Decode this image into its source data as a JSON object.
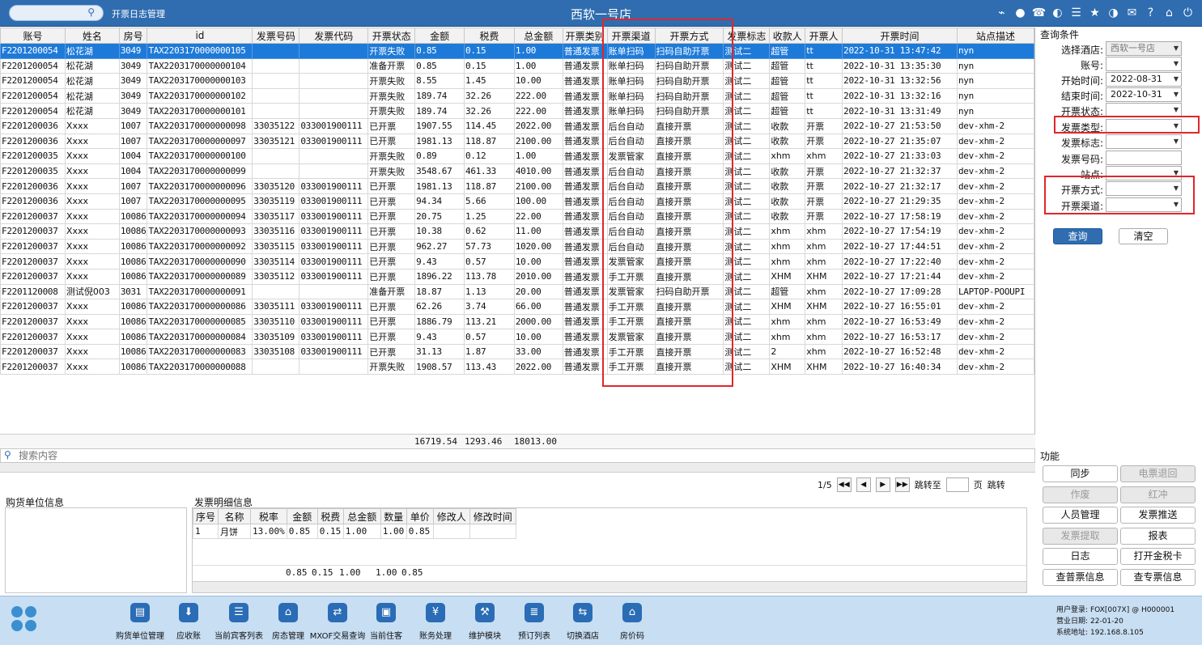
{
  "topbar": {
    "search_placeholder": "",
    "title": "开票日志管理",
    "hotel": "西软一号店",
    "icons": [
      "wifi-icon",
      "chat-icon",
      "phone-icon",
      "palette-icon",
      "menu-icon",
      "star-icon",
      "theme-icon",
      "mail-icon",
      "help-icon",
      "home-icon",
      "power-icon"
    ]
  },
  "grid": {
    "columns": [
      "账号",
      "姓名",
      "房号",
      "id",
      "发票号码",
      "发票代码",
      "开票状态",
      "金额",
      "税费",
      "总金额",
      "开票类别",
      "开票渠道",
      "开票方式",
      "发票标志",
      "收款人",
      "开票人",
      "开票时间",
      "站点描述"
    ],
    "rows": [
      [
        "F2201200054",
        "松花湖",
        "3049",
        "TAX2203170000000105",
        "",
        "",
        "开票失败",
        "0.85",
        "0.15",
        "1.00",
        "普通发票",
        "账单扫码",
        "扫码自助开票",
        "测试二",
        "超管",
        "tt",
        "2022-10-31 13:47:42",
        "nyn"
      ],
      [
        "F2201200054",
        "松花湖",
        "3049",
        "TAX2203170000000104",
        "",
        "",
        "准备开票",
        "0.85",
        "0.15",
        "1.00",
        "普通发票",
        "账单扫码",
        "扫码自助开票",
        "测试二",
        "超管",
        "tt",
        "2022-10-31 13:35:30",
        "nyn"
      ],
      [
        "F2201200054",
        "松花湖",
        "3049",
        "TAX2203170000000103",
        "",
        "",
        "开票失败",
        "8.55",
        "1.45",
        "10.00",
        "普通发票",
        "账单扫码",
        "扫码自助开票",
        "测试二",
        "超管",
        "tt",
        "2022-10-31 13:32:56",
        "nyn"
      ],
      [
        "F2201200054",
        "松花湖",
        "3049",
        "TAX2203170000000102",
        "",
        "",
        "开票失败",
        "189.74",
        "32.26",
        "222.00",
        "普通发票",
        "账单扫码",
        "扫码自助开票",
        "测试二",
        "超管",
        "tt",
        "2022-10-31 13:32:16",
        "nyn"
      ],
      [
        "F2201200054",
        "松花湖",
        "3049",
        "TAX2203170000000101",
        "",
        "",
        "开票失败",
        "189.74",
        "32.26",
        "222.00",
        "普通发票",
        "账单扫码",
        "扫码自助开票",
        "测试二",
        "超管",
        "tt",
        "2022-10-31 13:31:49",
        "nyn"
      ],
      [
        "F2201200036",
        "Xxxx",
        "1007",
        "TAX2203170000000098",
        "33035122",
        "033001900111",
        "已开票",
        "1907.55",
        "114.45",
        "2022.00",
        "普通发票",
        "后台自动",
        "直接开票",
        "测试二",
        "收款",
        "开票",
        "2022-10-27 21:53:50",
        "dev-xhm-2"
      ],
      [
        "F2201200036",
        "Xxxx",
        "1007",
        "TAX2203170000000097",
        "33035121",
        "033001900111",
        "已开票",
        "1981.13",
        "118.87",
        "2100.00",
        "普通发票",
        "后台自动",
        "直接开票",
        "测试二",
        "收款",
        "开票",
        "2022-10-27 21:35:07",
        "dev-xhm-2"
      ],
      [
        "F2201200035",
        "Xxxx",
        "1004",
        "TAX2203170000000100",
        "",
        "",
        "开票失败",
        "0.89",
        "0.12",
        "1.00",
        "普通发票",
        "发票管家",
        "直接开票",
        "测试二",
        "xhm",
        "xhm",
        "2022-10-27 21:33:03",
        "dev-xhm-2"
      ],
      [
        "F2201200035",
        "Xxxx",
        "1004",
        "TAX2203170000000099",
        "",
        "",
        "开票失败",
        "3548.67",
        "461.33",
        "4010.00",
        "普通发票",
        "后台自动",
        "直接开票",
        "测试二",
        "收款",
        "开票",
        "2022-10-27 21:32:37",
        "dev-xhm-2"
      ],
      [
        "F2201200036",
        "Xxxx",
        "1007",
        "TAX2203170000000096",
        "33035120",
        "033001900111",
        "已开票",
        "1981.13",
        "118.87",
        "2100.00",
        "普通发票",
        "后台自动",
        "直接开票",
        "测试二",
        "收款",
        "开票",
        "2022-10-27 21:32:17",
        "dev-xhm-2"
      ],
      [
        "F2201200036",
        "Xxxx",
        "1007",
        "TAX2203170000000095",
        "33035119",
        "033001900111",
        "已开票",
        "94.34",
        "5.66",
        "100.00",
        "普通发票",
        "后台自动",
        "直接开票",
        "测试二",
        "收款",
        "开票",
        "2022-10-27 21:29:35",
        "dev-xhm-2"
      ],
      [
        "F2201200037",
        "Xxxx",
        "10086",
        "TAX2203170000000094",
        "33035117",
        "033001900111",
        "已开票",
        "20.75",
        "1.25",
        "22.00",
        "普通发票",
        "后台自动",
        "直接开票",
        "测试二",
        "收款",
        "开票",
        "2022-10-27 17:58:19",
        "dev-xhm-2"
      ],
      [
        "F2201200037",
        "Xxxx",
        "10086",
        "TAX2203170000000093",
        "33035116",
        "033001900111",
        "已开票",
        "10.38",
        "0.62",
        "11.00",
        "普通发票",
        "后台自动",
        "直接开票",
        "测试二",
        "xhm",
        "xhm",
        "2022-10-27 17:54:19",
        "dev-xhm-2"
      ],
      [
        "F2201200037",
        "Xxxx",
        "10086",
        "TAX2203170000000092",
        "33035115",
        "033001900111",
        "已开票",
        "962.27",
        "57.73",
        "1020.00",
        "普通发票",
        "后台自动",
        "直接开票",
        "测试二",
        "xhm",
        "xhm",
        "2022-10-27 17:44:51",
        "dev-xhm-2"
      ],
      [
        "F2201200037",
        "Xxxx",
        "10086",
        "TAX2203170000000090",
        "33035114",
        "033001900111",
        "已开票",
        "9.43",
        "0.57",
        "10.00",
        "普通发票",
        "发票管家",
        "直接开票",
        "测试二",
        "xhm",
        "xhm",
        "2022-10-27 17:22:40",
        "dev-xhm-2"
      ],
      [
        "F2201200037",
        "Xxxx",
        "10086",
        "TAX2203170000000089",
        "33035112",
        "033001900111",
        "已开票",
        "1896.22",
        "113.78",
        "2010.00",
        "普通发票",
        "手工开票",
        "直接开票",
        "测试二",
        "XHM",
        "XHM",
        "2022-10-27 17:21:44",
        "dev-xhm-2"
      ],
      [
        "F2201120008",
        "测试倪003",
        "3031",
        "TAX2203170000000091",
        "",
        "",
        "准备开票",
        "18.87",
        "1.13",
        "20.00",
        "普通发票",
        "发票管家",
        "扫码自助开票",
        "测试二",
        "超管",
        "xhm",
        "2022-10-27 17:09:28",
        "LAPTOP-POOUPI"
      ],
      [
        "F2201200037",
        "Xxxx",
        "10086",
        "TAX2203170000000086",
        "33035111",
        "033001900111",
        "已开票",
        "62.26",
        "3.74",
        "66.00",
        "普通发票",
        "手工开票",
        "直接开票",
        "测试二",
        "XHM",
        "XHM",
        "2022-10-27 16:55:01",
        "dev-xhm-2"
      ],
      [
        "F2201200037",
        "Xxxx",
        "10086",
        "TAX2203170000000085",
        "33035110",
        "033001900111",
        "已开票",
        "1886.79",
        "113.21",
        "2000.00",
        "普通发票",
        "手工开票",
        "直接开票",
        "测试二",
        "xhm",
        "xhm",
        "2022-10-27 16:53:49",
        "dev-xhm-2"
      ],
      [
        "F2201200037",
        "Xxxx",
        "10086",
        "TAX2203170000000084",
        "33035109",
        "033001900111",
        "已开票",
        "9.43",
        "0.57",
        "10.00",
        "普通发票",
        "发票管家",
        "直接开票",
        "测试二",
        "xhm",
        "xhm",
        "2022-10-27 16:53:17",
        "dev-xhm-2"
      ],
      [
        "F2201200037",
        "Xxxx",
        "10086",
        "TAX2203170000000083",
        "33035108",
        "033001900111",
        "已开票",
        "31.13",
        "1.87",
        "33.00",
        "普通发票",
        "手工开票",
        "直接开票",
        "测试二",
        "2",
        "xhm",
        "2022-10-27 16:52:48",
        "dev-xhm-2"
      ],
      [
        "F2201200037",
        "Xxxx",
        "10086",
        "TAX2203170000000088",
        "",
        "",
        "开票失败",
        "1908.57",
        "113.43",
        "2022.00",
        "普通发票",
        "手工开票",
        "直接开票",
        "测试二",
        "XHM",
        "XHM",
        "2022-10-27 16:40:34",
        "dev-xhm-2"
      ]
    ],
    "totals": {
      "amount": "16719.54",
      "tax": "1293.46",
      "total": "18013.00"
    }
  },
  "search": {
    "placeholder": "搜索内容"
  },
  "pager": {
    "page": "1/5",
    "jump_label": "跳转至",
    "page_unit": "页",
    "jump_button": "跳转"
  },
  "buyer": {
    "title": "购货单位信息"
  },
  "detail": {
    "title": "发票明细信息",
    "columns": [
      "序号",
      "名称",
      "税率",
      "金额",
      "税费",
      "总金额",
      "数量",
      "单价",
      "修改人",
      "修改时间"
    ],
    "rows": [
      [
        "1",
        "月饼",
        "13.00%",
        "0.85",
        "0.15",
        "1.00",
        "1.00",
        "0.85",
        "",
        ""
      ]
    ],
    "totals": {
      "amount": "0.85",
      "tax": "0.15",
      "total": "1.00",
      "qty": "1.00",
      "price": "0.85"
    }
  },
  "query": {
    "title": "查询条件",
    "fields": [
      {
        "label": "选择酒店:",
        "value": "西软一号店"
      },
      {
        "label": "账号:",
        "value": ""
      },
      {
        "label": "开始时间:",
        "value": "2022-08-31"
      },
      {
        "label": "结束时间:",
        "value": "2022-10-31"
      },
      {
        "label": "开票状态:",
        "value": ""
      },
      {
        "label": "发票类型:",
        "value": ""
      },
      {
        "label": "发票标志:",
        "value": ""
      },
      {
        "label": "发票号码:",
        "value": ""
      },
      {
        "label": "站点:",
        "value": ""
      },
      {
        "label": "开票方式:",
        "value": ""
      },
      {
        "label": "开票渠道:",
        "value": ""
      }
    ],
    "search_button": "查询",
    "clear_button": "清空"
  },
  "functions": {
    "title": "功能",
    "buttons": [
      {
        "label": "同步",
        "enabled": true
      },
      {
        "label": "电票退回",
        "enabled": false
      },
      {
        "label": "作废",
        "enabled": false
      },
      {
        "label": "红冲",
        "enabled": false
      },
      {
        "label": "人员管理",
        "enabled": true
      },
      {
        "label": "发票推送",
        "enabled": true
      },
      {
        "label": "发票提取",
        "enabled": false
      },
      {
        "label": "报表",
        "enabled": true
      },
      {
        "label": "日志",
        "enabled": true
      },
      {
        "label": "打开金税卡",
        "enabled": true
      },
      {
        "label": "查普票信息",
        "enabled": true
      },
      {
        "label": "查专票信息",
        "enabled": true
      }
    ]
  },
  "toolbar": [
    {
      "label": "购货单位管理",
      "icon": "building-icon"
    },
    {
      "label": "应收账",
      "icon": "download-icon"
    },
    {
      "label": "当前宾客列表",
      "icon": "guest-list-icon"
    },
    {
      "label": "房态管理",
      "icon": "house-icon"
    },
    {
      "label": "MXOF交易查询",
      "icon": "exchange-icon"
    },
    {
      "label": "当前住客",
      "icon": "id-card-icon"
    },
    {
      "label": "账务处理",
      "icon": "money-icon"
    },
    {
      "label": "维护模块",
      "icon": "wrench-icon"
    },
    {
      "label": "预订列表",
      "icon": "document-icon"
    },
    {
      "label": "切换酒店",
      "icon": "switch-icon"
    },
    {
      "label": "房价码",
      "icon": "house-icon"
    }
  ],
  "status": {
    "user_label": "用户登录:",
    "user": "FOX[007X] @ H000001",
    "date_label": "营业日期:",
    "date": "22-01-20",
    "addr_label": "系统地址:",
    "addr": "192.168.8.105"
  },
  "colors": {
    "header_blue": "#2f6db0",
    "selected_row": "#1e7ad8",
    "highlight_red": "#e0262c",
    "toolbar_bg": "#c8def3"
  }
}
